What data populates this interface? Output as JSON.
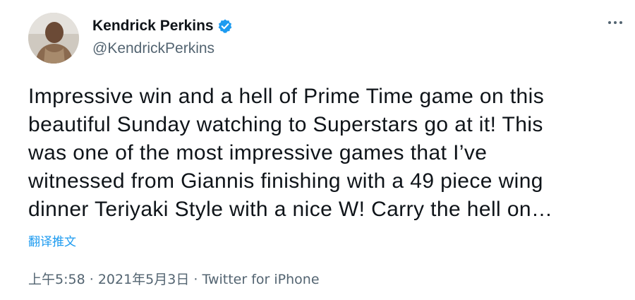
{
  "user": {
    "display_name": "Kendrick Perkins",
    "handle": "@KendrickPerkins",
    "verified_color": "#1d9bf0"
  },
  "tweet": {
    "lines": [
      "Impressive win and a hell of Prime Time game on this",
      "beautiful Sunday watching to Superstars go at it! This",
      "was one of the most impressive games that I’ve",
      "witnessed from Giannis finishing with a 49 piece wing",
      "dinner Teriyaki Style with a nice W! Carry the hell on…"
    ],
    "translate_label": "翻译推文"
  },
  "meta": {
    "time": "上午5:58",
    "separator": "·",
    "date": "2021年5月3日",
    "source": "Twitter for iPhone"
  },
  "icons": {
    "more": "more-options-icon",
    "verified": "verified-badge-icon"
  }
}
